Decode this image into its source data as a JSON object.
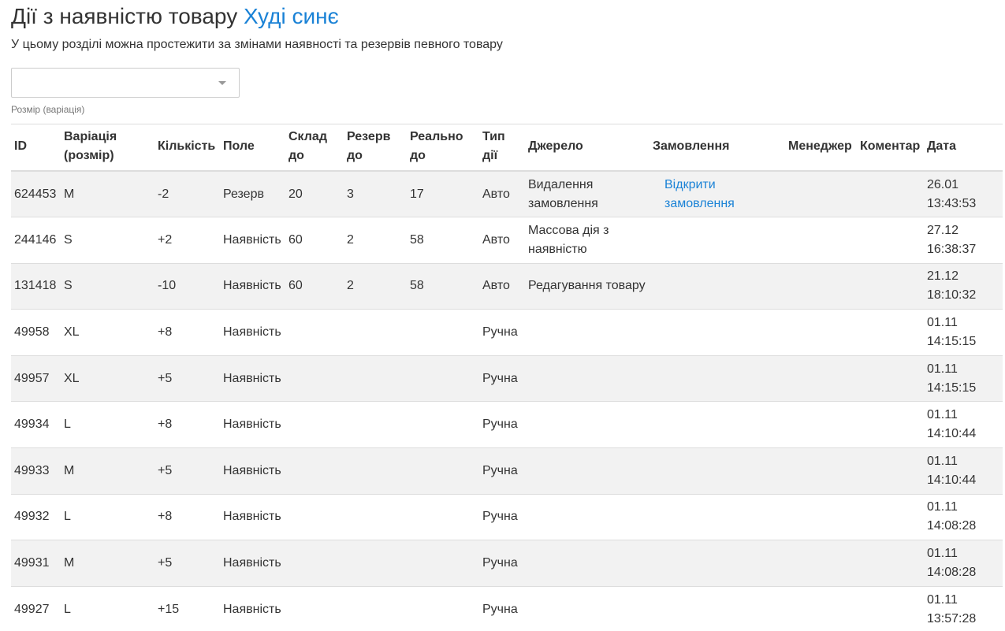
{
  "header": {
    "title_prefix": "Дії з наявністю товару",
    "product_name": "Худі синє",
    "subtitle": "У цьому розділі можна простежити за змінами наявності та резервів певного товару"
  },
  "filter": {
    "variation_value": "",
    "help_text": "Розмір (варіація)"
  },
  "table": {
    "columns": {
      "id": "ID",
      "variation": "Варіація (розмір)",
      "quantity": "Кількість",
      "field": "Поле",
      "stock_before": "Склад до",
      "reserve_before": "Резерв до",
      "real_before": "Реально до",
      "action_type": "Тип дії",
      "source": "Джерело",
      "order": "Замовлення",
      "manager": "Менеджер",
      "comment": "Коментар",
      "date": "Дата"
    },
    "rows": [
      {
        "id": "624453",
        "variation": "M",
        "quantity": "-2",
        "field": "Резерв",
        "stock_before": "20",
        "reserve_before": "3",
        "real_before": "17",
        "action_type": "Авто",
        "source": "Видалення замовлення",
        "order": "Відкрити замовлення",
        "manager": "",
        "comment": "",
        "date": "26.01 13:43:53"
      },
      {
        "id": "244146",
        "variation": "S",
        "quantity": "+2",
        "field": "Наявність",
        "stock_before": "60",
        "reserve_before": "2",
        "real_before": "58",
        "action_type": "Авто",
        "source": "Массова дія з наявністю",
        "order": "",
        "manager": "",
        "comment": "",
        "date": "27.12 16:38:37"
      },
      {
        "id": "131418",
        "variation": "S",
        "quantity": "-10",
        "field": "Наявність",
        "stock_before": "60",
        "reserve_before": "2",
        "real_before": "58",
        "action_type": "Авто",
        "source": "Редагування товару",
        "order": "",
        "manager": "",
        "comment": "",
        "date": "21.12 18:10:32"
      },
      {
        "id": "49958",
        "variation": "XL",
        "quantity": "+8",
        "field": "Наявність",
        "stock_before": "",
        "reserve_before": "",
        "real_before": "",
        "action_type": "Ручна",
        "source": "",
        "order": "",
        "manager": "",
        "comment": "",
        "date": "01.11 14:15:15"
      },
      {
        "id": "49957",
        "variation": "XL",
        "quantity": "+5",
        "field": "Наявність",
        "stock_before": "",
        "reserve_before": "",
        "real_before": "",
        "action_type": "Ручна",
        "source": "",
        "order": "",
        "manager": "",
        "comment": "",
        "date": "01.11 14:15:15"
      },
      {
        "id": "49934",
        "variation": "L",
        "quantity": "+8",
        "field": "Наявність",
        "stock_before": "",
        "reserve_before": "",
        "real_before": "",
        "action_type": "Ручна",
        "source": "",
        "order": "",
        "manager": "",
        "comment": "",
        "date": "01.11 14:10:44"
      },
      {
        "id": "49933",
        "variation": "M",
        "quantity": "+5",
        "field": "Наявність",
        "stock_before": "",
        "reserve_before": "",
        "real_before": "",
        "action_type": "Ручна",
        "source": "",
        "order": "",
        "manager": "",
        "comment": "",
        "date": "01.11 14:10:44"
      },
      {
        "id": "49932",
        "variation": "L",
        "quantity": "+8",
        "field": "Наявність",
        "stock_before": "",
        "reserve_before": "",
        "real_before": "",
        "action_type": "Ручна",
        "source": "",
        "order": "",
        "manager": "",
        "comment": "",
        "date": "01.11 14:08:28"
      },
      {
        "id": "49931",
        "variation": "M",
        "quantity": "+5",
        "field": "Наявність",
        "stock_before": "",
        "reserve_before": "",
        "real_before": "",
        "action_type": "Ручна",
        "source": "",
        "order": "",
        "manager": "",
        "comment": "",
        "date": "01.11 14:08:28"
      },
      {
        "id": "49927",
        "variation": "L",
        "quantity": "+15",
        "field": "Наявність",
        "stock_before": "",
        "reserve_before": "",
        "real_before": "",
        "action_type": "Ручна",
        "source": "",
        "order": "",
        "manager": "",
        "comment": "",
        "date": "01.11 13:57:28"
      }
    ]
  },
  "colors": {
    "link": "#1a82d6",
    "stripe": "#f2f2f2",
    "border": "#dddddd"
  }
}
